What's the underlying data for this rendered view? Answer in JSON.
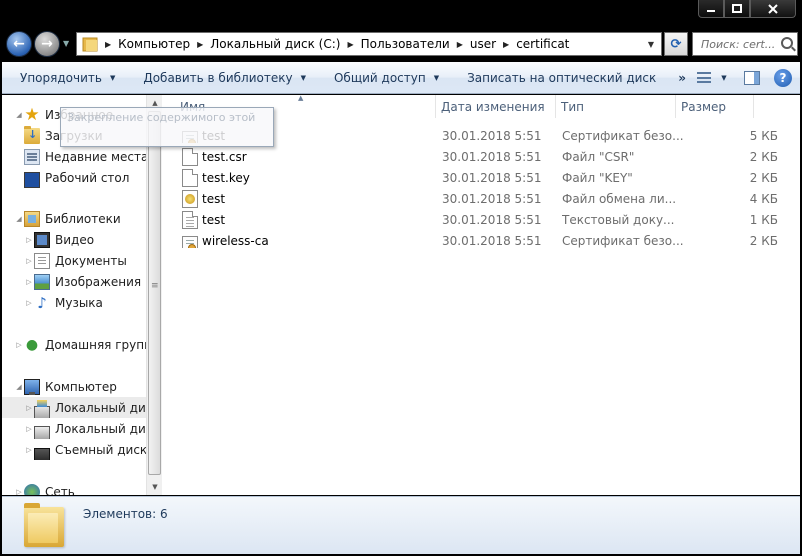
{
  "window": {
    "controls": [
      "minimize-icon",
      "maximize-icon",
      "close-icon"
    ]
  },
  "address": {
    "crumbs": [
      "Компьютер",
      "Локальный диск (C:)",
      "Пользователи",
      "user",
      "certificat"
    ],
    "search_placeholder": "Поиск: cert..."
  },
  "toolbar": {
    "organize": "Упорядочить",
    "add_library": "Добавить в библиотеку",
    "share": "Общий доступ",
    "burn": "Записать на оптический диск",
    "more": "»"
  },
  "sidebar": {
    "favorites": {
      "label": "Избранное",
      "items": [
        "Загрузки",
        "Недавние места",
        "Рабочий стол"
      ]
    },
    "libraries": {
      "label": "Библиотеки",
      "items": [
        "Видео",
        "Документы",
        "Изображения",
        "Музыка"
      ]
    },
    "homegroup": "Домашняя группа",
    "computer": {
      "label": "Компьютер",
      "items": [
        "Локальный диск",
        "Локальный диск",
        "Съемный диск ("
      ]
    },
    "network": "Сеть"
  },
  "tooltip": "Закрепление содержимого этой",
  "columns": {
    "name": "Имя",
    "date": "Дата изменения",
    "type": "Тип",
    "size": "Размер"
  },
  "files": [
    {
      "icon": "certificate-icon",
      "name": "test",
      "date": "30.01.2018 5:51",
      "type": "Сертификат безо...",
      "size": "5 КБ"
    },
    {
      "icon": "file-icon",
      "name": "test.csr",
      "date": "30.01.2018 5:51",
      "type": "Файл \"CSR\"",
      "size": "2 КБ"
    },
    {
      "icon": "file-icon",
      "name": "test.key",
      "date": "30.01.2018 5:51",
      "type": "Файл \"KEY\"",
      "size": "2 КБ"
    },
    {
      "icon": "pfx-icon",
      "name": "test",
      "date": "30.01.2018 5:51",
      "type": "Файл обмена ли...",
      "size": "4 КБ"
    },
    {
      "icon": "text-file-icon",
      "name": "test",
      "date": "30.01.2018 5:51",
      "type": "Текстовый доку...",
      "size": "1 КБ"
    },
    {
      "icon": "certificate-icon",
      "name": "wireless-ca",
      "date": "30.01.2018 5:51",
      "type": "Сертификат безо...",
      "size": "2 КБ"
    }
  ],
  "status": {
    "count": "Элементов: 6"
  }
}
